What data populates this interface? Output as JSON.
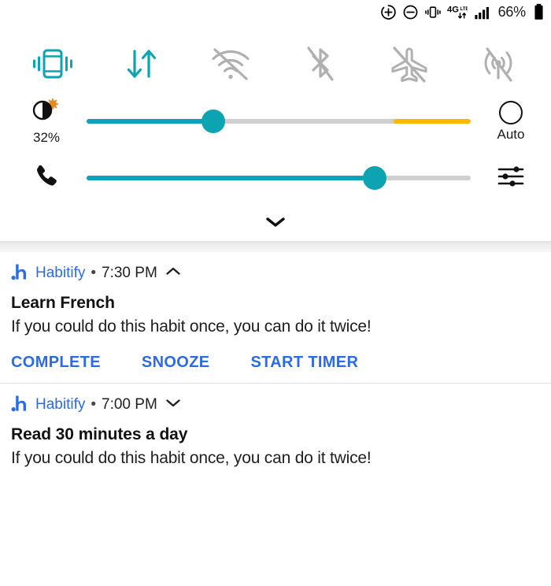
{
  "status_bar": {
    "icons": [
      "add-circle-icon",
      "do-not-disturb-icon",
      "vibrate-icon",
      "4g-lte-data-icon",
      "signal-bars-icon"
    ],
    "network_label": "4G",
    "network_sub": "LTE",
    "battery_percent": "66%"
  },
  "quick_settings": {
    "toggles": [
      {
        "name": "vibrate-toggle",
        "label": "Vibrate",
        "active": true
      },
      {
        "name": "data-toggle",
        "label": "Mobile data",
        "active": true
      },
      {
        "name": "wifi-toggle",
        "label": "Wi-Fi",
        "active": false
      },
      {
        "name": "bluetooth-toggle",
        "label": "Bluetooth",
        "active": false
      },
      {
        "name": "airplane-toggle",
        "label": "Airplane mode",
        "active": false
      },
      {
        "name": "hotspot-toggle",
        "label": "Hotspot",
        "active": false
      }
    ],
    "brightness": {
      "value_label": "32%",
      "fill_percent": 33,
      "warn_start_percent": 80,
      "auto_label": "Auto",
      "auto_on": false
    },
    "volume": {
      "fill_percent": 75
    },
    "expand_icon": "chevron-down-icon",
    "colors": {
      "accent_teal": "#0CA3B2",
      "warn_yellow": "#FCB800",
      "inactive_gray": "#b0b0b0",
      "track_gray": "#cfcfcf"
    }
  },
  "notifications": [
    {
      "app_name": "Habitify",
      "separator": "•",
      "time": "7:30 PM",
      "expanded": true,
      "chevron": "chevron-up-icon",
      "title": "Learn French",
      "body": "If you could do this habit once, you can do it twice!",
      "actions": [
        "COMPLETE",
        "SNOOZE",
        "START TIMER"
      ]
    },
    {
      "app_name": "Habitify",
      "separator": "•",
      "time": "7:00 PM",
      "expanded": false,
      "chevron": "chevron-down-icon",
      "title": "Read 30 minutes a day",
      "body": "If you could do this habit once, you can do it twice!",
      "actions": []
    }
  ],
  "theme": {
    "link_blue": "#2C6BE0",
    "background": "#ffffff"
  }
}
